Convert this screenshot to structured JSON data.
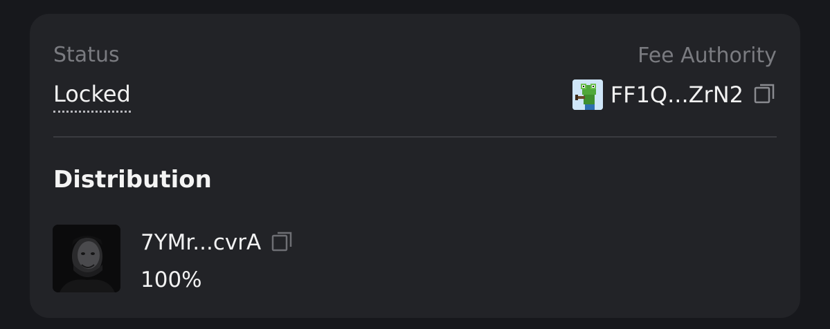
{
  "status": {
    "label": "Status",
    "value": "Locked"
  },
  "fee_authority": {
    "label": "Fee Authority",
    "address": "FF1Q...ZrN2",
    "avatar_icon": "frog-avatar-icon"
  },
  "distribution": {
    "title": "Distribution",
    "recipients": [
      {
        "address": "7YMr...cvrA",
        "percent": "100%",
        "avatar_icon": "portrait-avatar-icon"
      }
    ]
  },
  "colors": {
    "background": "#17181c",
    "card": "#222327",
    "muted_text": "#7a7b80",
    "text": "#f2f2f2"
  }
}
